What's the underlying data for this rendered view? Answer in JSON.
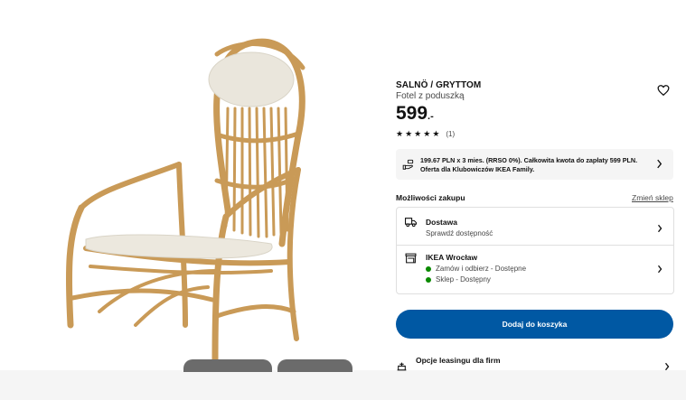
{
  "product": {
    "name": "SALNÖ / GRYTTOM",
    "subtitle": "Fotel z poduszką",
    "price_main": "599",
    "price_decimal": ".-",
    "rating_count": "(1)",
    "stars": 5
  },
  "installment": {
    "text": "199.67 PLN x 3 mies. (RRSO 0%). Całkowita kwota do zapłaty 599 PLN. Oferta dla Klubowiczów IKEA Family."
  },
  "purchase": {
    "section_title": "Możliwości zakupu",
    "change_store": "Zmień sklep",
    "delivery": {
      "title": "Dostawa",
      "subtitle": "Sprawdź dostępność"
    },
    "store": {
      "title": "IKEA Wrocław",
      "line1": "Zamów i odbierz - Dostępne",
      "line2": "Sklep - Dostępny",
      "status_color": "#0a8a00"
    }
  },
  "cart": {
    "button_label": "Dodaj do koszyka",
    "color": "#0058a3"
  },
  "leasing": {
    "title": "Opcje leasingu dla firm"
  },
  "icons": {
    "wishlist": "heart-icon",
    "installment": "hand-payment-icon",
    "delivery": "truck-icon",
    "store": "store-icon",
    "leasing": "leasing-icon"
  }
}
